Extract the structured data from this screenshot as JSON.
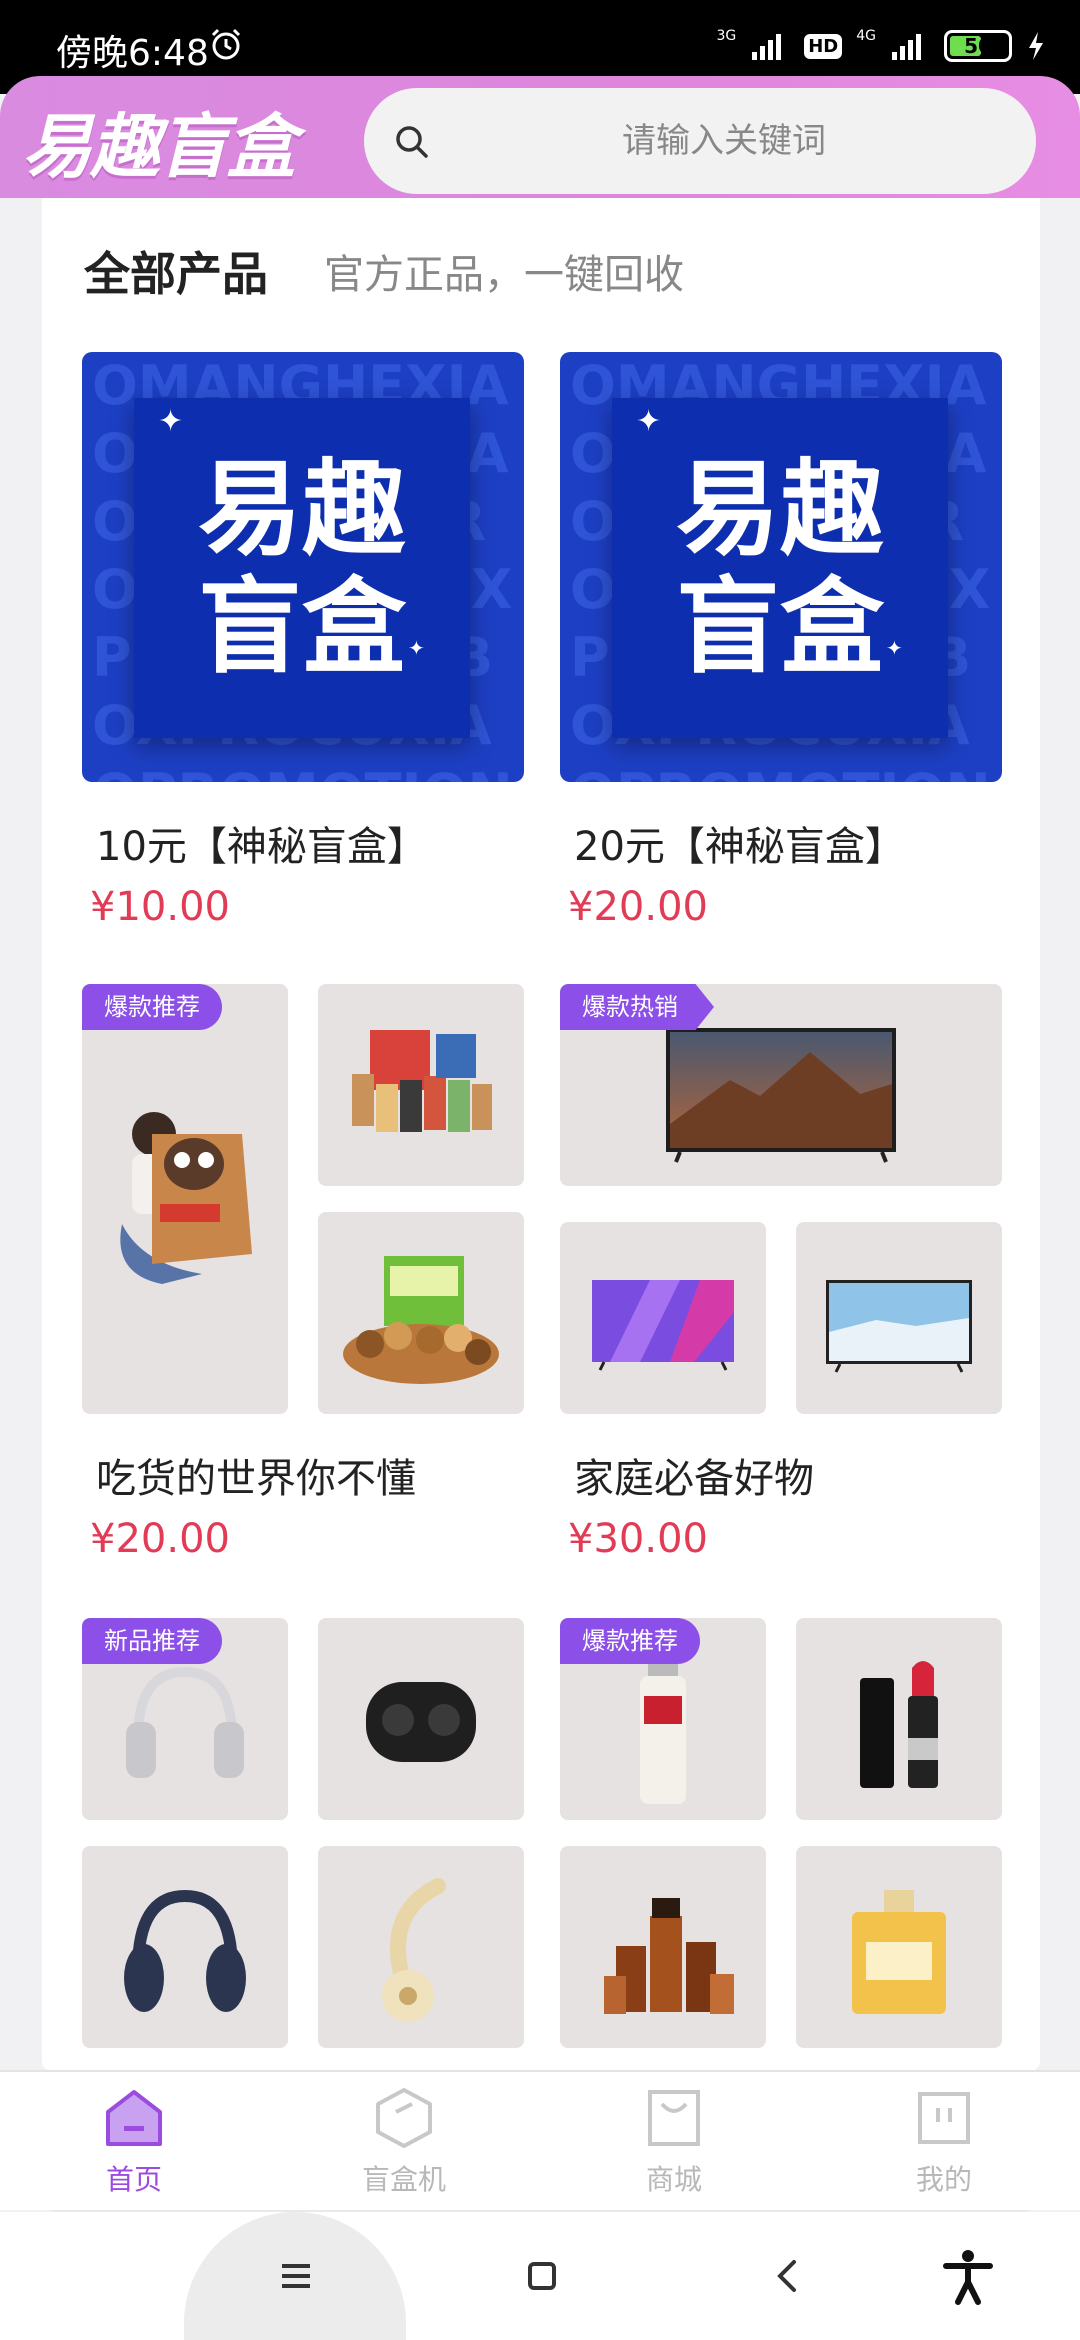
{
  "status_bar": {
    "time": "傍晚6:48",
    "network_1": "3G",
    "hd": "HD",
    "network_2": "4G",
    "battery": "50"
  },
  "header": {
    "brand": "易趣盲盒",
    "search_placeholder": "请输入关键词"
  },
  "section": {
    "title": "全部产品",
    "subtitle": "官方正品，一键回收"
  },
  "products": [
    {
      "name": "10元【神秘盲盒】",
      "price": "¥10.00",
      "image_text_1": "易趣",
      "image_text_2": "盲盒",
      "pattern": "OMANGHEXIAOMANGHEXIAOMANGHEPROMOTIONBOXPROCUXIAOBOXPROCUXIAOPROMOTIONBOXPROCUXIAOMANGHE"
    },
    {
      "name": "20元【神秘盲盒】",
      "price": "¥20.00",
      "image_text_1": "易趣",
      "image_text_2": "盲盒",
      "pattern": "OMANGHEXIAOMANGHEXIAOMANGHEPROMOTIONBOXPROCUXIAOBOXPROCUXIAOPROMOTIONBOXPROCUXIAOMANGHE"
    },
    {
      "name": "吃货的世界你不懂",
      "price": "¥20.00",
      "tag": "爆款推荐"
    },
    {
      "name": "家庭必备好物",
      "price": "¥30.00",
      "tag": "爆款热销"
    },
    {
      "tag": "新品推荐"
    },
    {
      "tag": "爆款推荐"
    }
  ],
  "bottom_nav": [
    {
      "label": "首页",
      "icon": "home-icon",
      "active": true
    },
    {
      "label": "盲盒机",
      "icon": "cube-icon",
      "active": false
    },
    {
      "label": "商城",
      "icon": "shop-bag-icon",
      "active": false
    },
    {
      "label": "我的",
      "icon": "profile-icon",
      "active": false
    }
  ],
  "colors": {
    "accent": "#9b4cde",
    "header": "#dd86dc",
    "price": "#e23b55",
    "tag": "#8c4fe8",
    "blue_box": "#1d3fc4"
  }
}
